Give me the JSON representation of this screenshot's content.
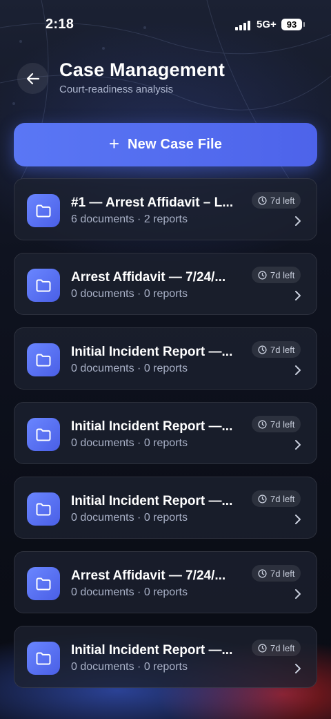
{
  "status_bar": {
    "time": "2:18",
    "network": "5G+",
    "battery": "93"
  },
  "header": {
    "title": "Case Management",
    "subtitle": "Court-readiness analysis"
  },
  "new_case_button": {
    "label": "New Case File"
  },
  "cases": [
    {
      "title": "#1 — Arrest Affidavit – L...",
      "meta": "6 documents · 2 reports",
      "deadline": "7d left"
    },
    {
      "title": "Arrest Affidavit — 7/24/...",
      "meta": "0 documents · 0 reports",
      "deadline": "7d left"
    },
    {
      "title": "Initial Incident Report —...",
      "meta": "0 documents · 0 reports",
      "deadline": "7d left"
    },
    {
      "title": "Initial Incident Report —...",
      "meta": "0 documents · 0 reports",
      "deadline": "7d left"
    },
    {
      "title": "Initial Incident Report —...",
      "meta": "0 documents · 0 reports",
      "deadline": "7d left"
    },
    {
      "title": "Arrest Affidavit — 7/24/...",
      "meta": "0 documents · 0 reports",
      "deadline": "7d left"
    },
    {
      "title": "Initial Incident Report —...",
      "meta": "0 documents · 0 reports",
      "deadline": "7d left"
    }
  ],
  "colors": {
    "accent": "#5a77f5",
    "background": "#0f1320",
    "card": "#1c2130",
    "muted_text": "#a9b1c7"
  }
}
